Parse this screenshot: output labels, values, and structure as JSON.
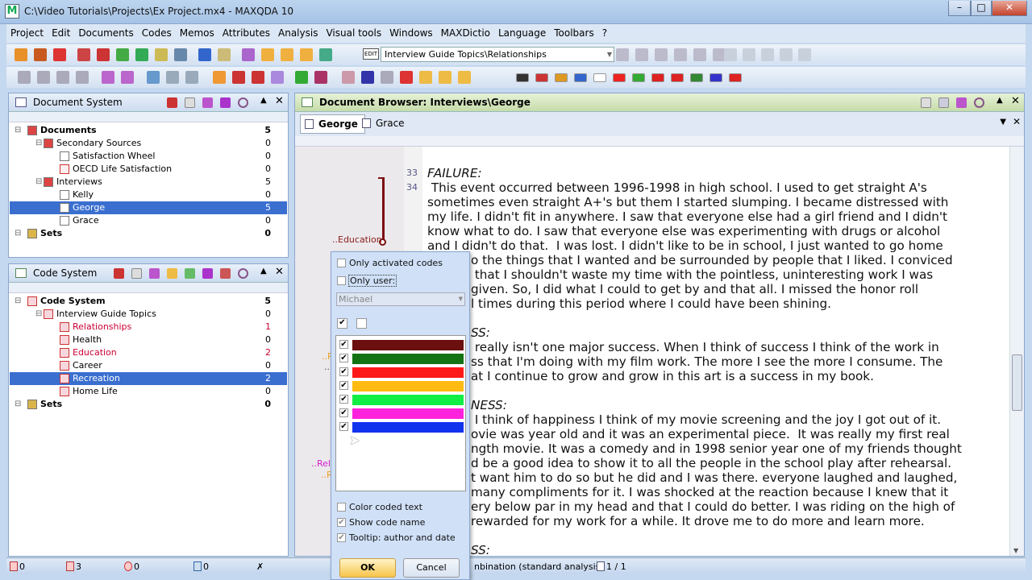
{
  "window": {
    "title": "C:\\Video Tutorials\\Projects\\Ex Project.mx4 - MAXQDA 10",
    "icon": "M",
    "min": "–",
    "max": "□",
    "close": "✕"
  },
  "menu": [
    "Project",
    "Edit",
    "Documents",
    "Codes",
    "Memos",
    "Attributes",
    "Analysis",
    "Visual tools",
    "Windows",
    "MAXDictio",
    "Language",
    "Toolbars",
    "?"
  ],
  "toolbar": {
    "code_combo": "Interview Guide Topics\\Relationships",
    "combo_icon": "EDIT"
  },
  "document_system": {
    "title": "Document System",
    "items": [
      {
        "label": "Documents",
        "count": "5",
        "level": 0,
        "bold": true,
        "icon": "documents-icon"
      },
      {
        "label": "Secondary Sources",
        "count": "0",
        "level": 1,
        "icon": "folder-icon"
      },
      {
        "label": "Satisfaction Wheel",
        "count": "0",
        "level": 2,
        "icon": "document-icon"
      },
      {
        "label": "OECD Life Satisfaction",
        "count": "0",
        "level": 2,
        "icon": "pdf-icon"
      },
      {
        "label": "Interviews",
        "count": "5",
        "level": 1,
        "icon": "folder-icon"
      },
      {
        "label": "Kelly",
        "count": "0",
        "level": 2,
        "icon": "document-icon"
      },
      {
        "label": "George",
        "count": "5",
        "level": 2,
        "selected": true,
        "icon": "document-edit-icon"
      },
      {
        "label": "Grace",
        "count": "0",
        "level": 2,
        "icon": "document-icon"
      },
      {
        "label": "Sets",
        "count": "0",
        "level": 0,
        "bold": true,
        "icon": "sets-icon"
      }
    ]
  },
  "code_system": {
    "title": "Code System",
    "items": [
      {
        "label": "Code System",
        "count": "5",
        "level": 0,
        "bold": true,
        "icon": "code-system-icon"
      },
      {
        "label": "Interview Guide Topics",
        "count": "0",
        "level": 1,
        "icon": "code-icon"
      },
      {
        "label": "Relationships",
        "count": "1",
        "level": 2,
        "color": "#cc0033",
        "icon": "code-icon"
      },
      {
        "label": "Health",
        "count": "0",
        "level": 2,
        "icon": "code-icon"
      },
      {
        "label": "Education",
        "count": "2",
        "level": 2,
        "color": "#cc0033",
        "icon": "code-icon"
      },
      {
        "label": "Career",
        "count": "0",
        "level": 2,
        "icon": "code-icon"
      },
      {
        "label": "Recreation",
        "count": "2",
        "level": 2,
        "selected": true,
        "icon": "code-icon"
      },
      {
        "label": "Home Life",
        "count": "0",
        "level": 2,
        "icon": "code-icon"
      },
      {
        "label": "Sets",
        "count": "0",
        "level": 0,
        "bold": true,
        "icon": "sets-icon"
      }
    ]
  },
  "browser": {
    "title": "Document Browser: Interviews\\George",
    "tabs": [
      "George",
      "Grace"
    ],
    "margin_labels": [
      {
        "text": "..Education",
        "color": "#8b1a1a"
      },
      {
        "text": "..R",
        "color": "#e8a020"
      },
      {
        "text": "..",
        "color": "#555"
      },
      {
        "text": "..Rel",
        "color": "#d020d0"
      },
      {
        "text": "..R",
        "color": "#e8a020"
      }
    ],
    "lines": [
      {
        "num": "33",
        "text": "FAILURE:",
        "italic": true
      },
      {
        "num": "34",
        "text": " This event occurred between 1996-1998 in high school. I used to get straight A's"
      },
      {
        "text": "sometimes even straight A+'s but them I started slumping. I became distressed with"
      },
      {
        "text": "my life. I didn't fit in anywhere. I saw that everyone else had a girl friend and I didn't"
      },
      {
        "text": "know what to do. I saw that everyone else was experimenting with drugs or alcohol"
      },
      {
        "text": "and I didn't do that.  I was lost. I didn't like to be in school, I just wanted to go home"
      },
      {
        "text": "o the things that I wanted and be surrounded by people that I liked. I conviced",
        "occluded": true
      },
      {
        "text": " that I shouldn't waste my time with the pointless, uninteresting work I was",
        "occluded": true
      },
      {
        "text": "given. So, I did what I could to get by and that all. I missed the honor roll",
        "occluded": true
      },
      {
        "text": "l times during this period where I could have been shining.",
        "occluded": true
      },
      {
        "text": ""
      },
      {
        "text": "SS:",
        "occluded": true,
        "italic": true
      },
      {
        "text": " really isn't one major success. When I think of success I think of the work in",
        "occluded": true
      },
      {
        "text": "ss that I'm doing with my film work. The more I see the more I consume. The",
        "occluded": true
      },
      {
        "text": "at I continue to grow and grow in this art is a success in my book.",
        "occluded": true
      },
      {
        "text": ""
      },
      {
        "text": "NESS:",
        "occluded": true,
        "italic": true
      },
      {
        "text": " I think of happiness I think of my movie screening and the joy I got out of it.",
        "occluded": true
      },
      {
        "text": "ovie was year old and it was an experimental piece.  It was really my first real",
        "occluded": true
      },
      {
        "text": "ngth movie. It was a comedy and in 1998 senior year one of my friends thought",
        "occluded": true
      },
      {
        "text": "d be a good idea to show it to all the people in the school play after rehearsal.",
        "occluded": true
      },
      {
        "text": "t want him to do so but he did and I was there. everyone laughed and laughed,",
        "occluded": true
      },
      {
        "text": "many compliments for it. I was shocked at the reaction because I knew that it",
        "occluded": true
      },
      {
        "text": "ery below par in my head and that I could do better. I was riding on the high of",
        "occluded": true
      },
      {
        "text": "rewarded for my work for a while. It drove me to do more and learn more.",
        "occluded": true
      },
      {
        "text": ""
      },
      {
        "text": "SS:",
        "occluded": true,
        "italic": true
      }
    ]
  },
  "popup": {
    "only_activated": "Only activated codes",
    "only_user": "Only user:",
    "user": "Michael",
    "colors": [
      "#6b0f0f",
      "#137313",
      "#ff1a1a",
      "#ffbb11",
      "#11ee44",
      "#ff22dd",
      "#1133ee"
    ],
    "color_coded_text": "Color coded text",
    "show_code_name": "Show code name",
    "tooltip": "Tooltip: author and date",
    "ok": "OK",
    "cancel": "Cancel"
  },
  "status": {
    "docs": "0",
    "coded": "3",
    "codes": "0",
    "memos": "0",
    "mode": "nbination (standard analysis)",
    "pages": "1 / 1"
  }
}
